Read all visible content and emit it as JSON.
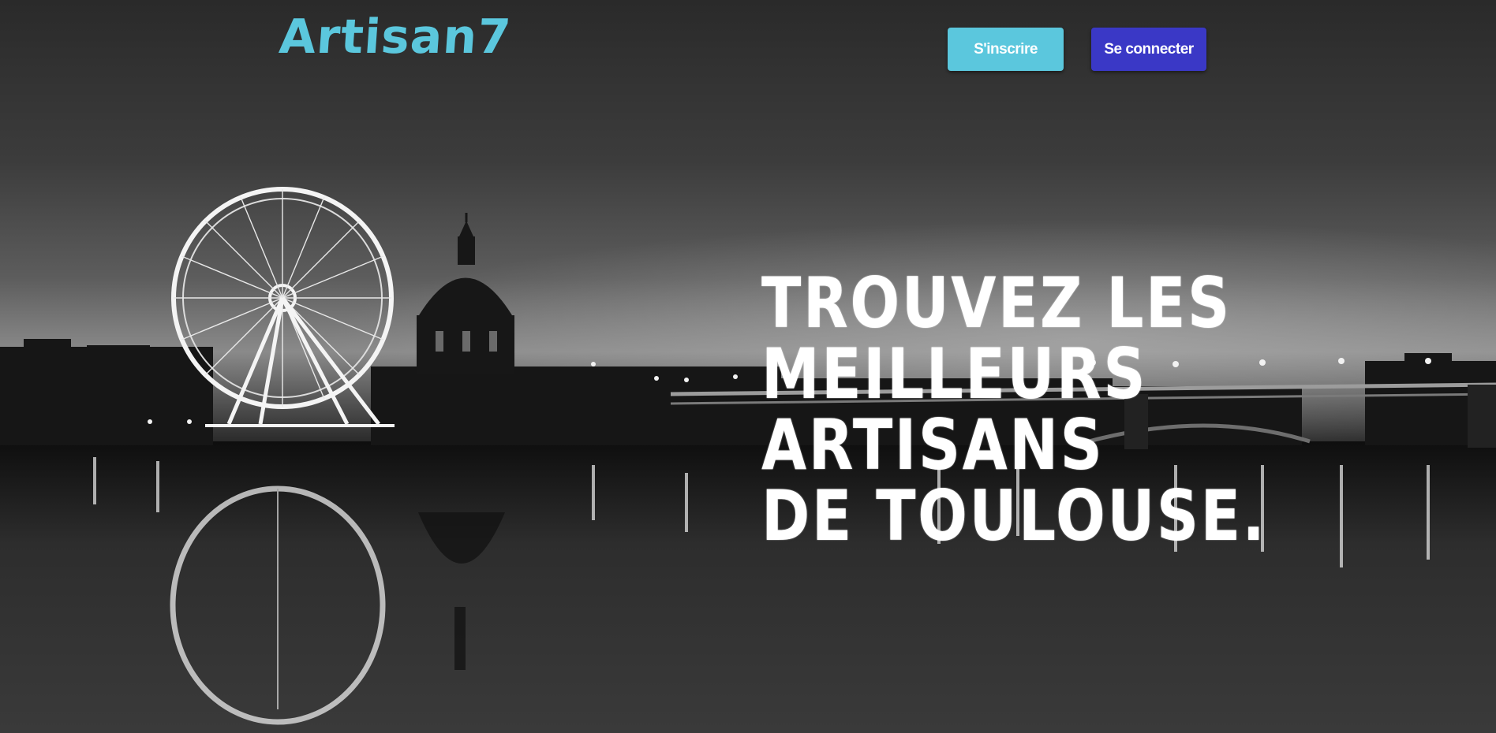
{
  "header": {
    "logo_text": "Artisan7",
    "signup_label": "S'inscrire",
    "login_label": "Se connecter"
  },
  "hero": {
    "headline_lines": [
      "TROUVEZ LES",
      "MEILLEURS",
      "ARTISANS",
      "DE TOULOUSE."
    ]
  },
  "colors": {
    "brand": "#5bc7dd",
    "login_button": "#3a38c6",
    "headline": "#ffffff"
  },
  "icons": [
    "ferris-wheel",
    "dome",
    "bridge"
  ]
}
